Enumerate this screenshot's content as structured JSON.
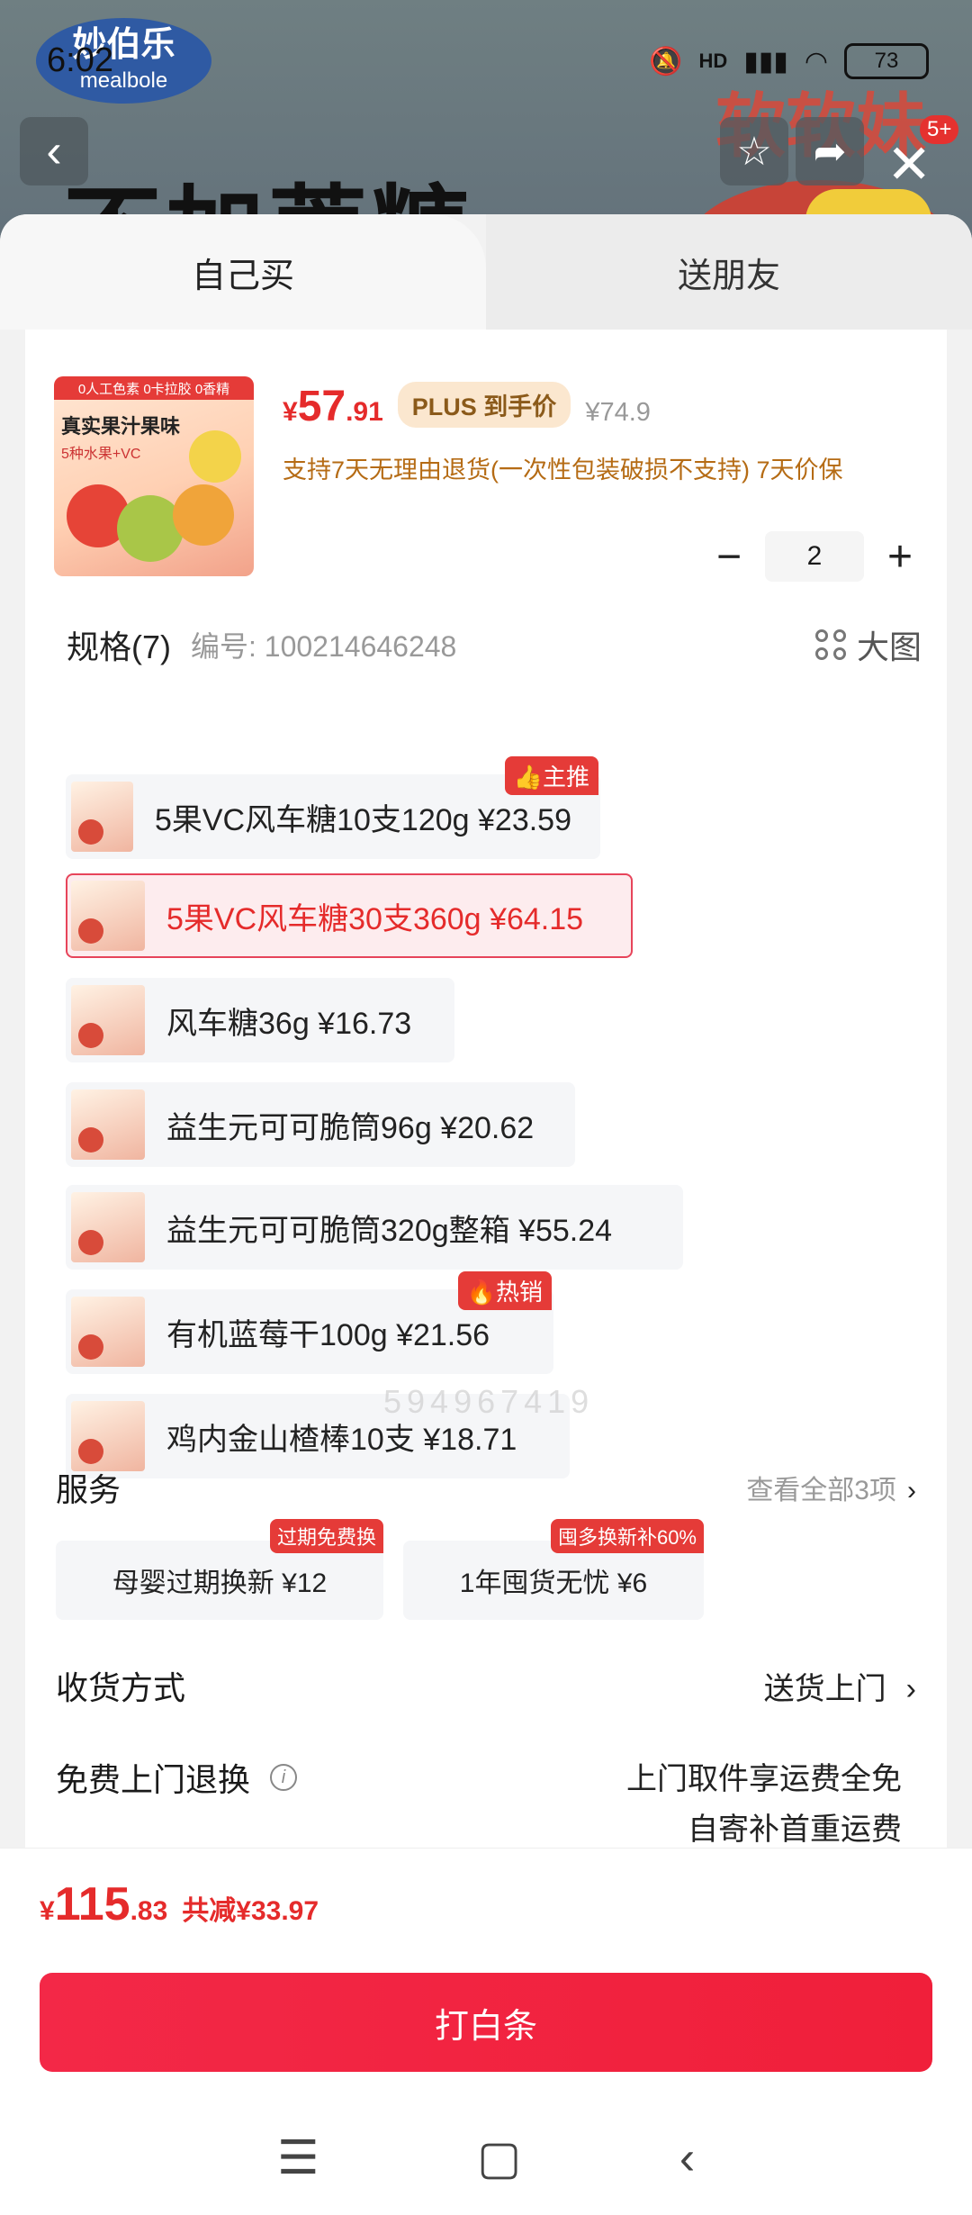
{
  "status": {
    "time": "6:02",
    "battery": "73",
    "network": "HD"
  },
  "background": {
    "brand": "妙伯乐",
    "brand_en": "mealbole",
    "headline": "不加蔗糖",
    "promo": "软软妹",
    "badge": "5+"
  },
  "tabs": [
    {
      "label": "自己买"
    },
    {
      "label": "送朋友"
    }
  ],
  "product": {
    "price_currency": "¥",
    "price_int": "57",
    "price_dec": ".91",
    "plus_tag": "PLUS 到手价",
    "original_price": "¥74.9",
    "policy": "支持7天无理由退货(一次性包装破损不支持) 7天价保",
    "quantity": "2",
    "box_top": "0人工色素 0卡拉胶 0香精",
    "box_title": "真实果汁果味",
    "box_sub": "5种水果+VC"
  },
  "spec": {
    "title": "规格(7)",
    "code": "编号: 100214646248",
    "big_view": "大图",
    "items": [
      {
        "label": "5果VC风车糖10支120g  ¥23.59",
        "tag": "主推",
        "selected": false
      },
      {
        "label": "5果VC风车糖30支360g  ¥64.15",
        "tag": "",
        "selected": true
      },
      {
        "label": "风车糖36g  ¥16.73",
        "tag": "",
        "selected": false
      },
      {
        "label": "益生元可可脆筒96g  ¥20.62",
        "tag": "",
        "selected": false
      },
      {
        "label": "益生元可可脆筒320g整箱  ¥55.24",
        "tag": "",
        "selected": false
      },
      {
        "label": "有机蓝莓干100g  ¥21.56",
        "tag": "热销",
        "selected": false
      },
      {
        "label": "鸡内金山楂棒10支  ¥18.71",
        "tag": "",
        "selected": false
      }
    ]
  },
  "service": {
    "title": "服务",
    "more": "查看全部3项",
    "items": [
      {
        "label": "母婴过期换新  ¥12",
        "tag": "过期免费换"
      },
      {
        "label": "1年囤货无忧  ¥6",
        "tag": "囤多换新补60%"
      }
    ]
  },
  "delivery": {
    "title": "收货方式",
    "value": "送货上门"
  },
  "return": {
    "title": "免费上门退换",
    "line1": "上门取件享运费全免",
    "line2": "自寄补首重运费"
  },
  "footer": {
    "total_currency": "¥",
    "total_int": "115",
    "total_dec": ".83",
    "saving": "共减¥33.97",
    "pay_button": "打白条"
  },
  "watermark": "594967419",
  "colors": {
    "accent": "#e52b2b",
    "button": "#f32847",
    "plus_bg": "#fbe7cf",
    "policy_text": "#b56b14"
  }
}
